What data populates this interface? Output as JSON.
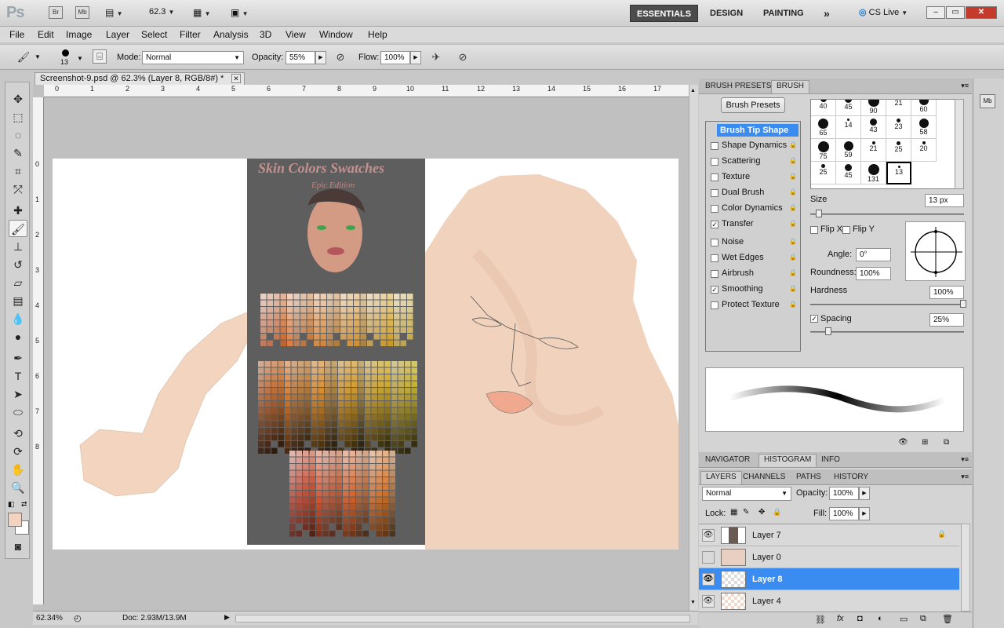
{
  "app": {
    "logo": "Ps",
    "bridge": "Br",
    "minibridge": "Mb",
    "zoom_display": "62.3",
    "workspaces": [
      "ESSENTIALS",
      "DESIGN",
      "PAINTING"
    ],
    "more": "»",
    "cslive": "CS Live",
    "window_controls": [
      "–",
      "▭",
      "✕"
    ]
  },
  "menu": [
    "File",
    "Edit",
    "Image",
    "Layer",
    "Select",
    "Filter",
    "Analysis",
    "3D",
    "View",
    "Window",
    "Help"
  ],
  "options": {
    "brush_size": "13",
    "mode_label": "Mode:",
    "mode_value": "Normal",
    "opacity_label": "Opacity:",
    "opacity_value": "55%",
    "flow_label": "Flow:",
    "flow_value": "100%"
  },
  "document": {
    "tab_title": "Screenshot-9.psd @ 62.3% (Layer 8, RGB/8#) *",
    "ruler_h": [
      "0",
      "1",
      "2",
      "3",
      "4",
      "5",
      "6",
      "7",
      "8",
      "9",
      "10",
      "11",
      "12",
      "13",
      "14",
      "15",
      "16",
      "17"
    ],
    "ruler_v": [
      "0",
      "1",
      "2",
      "3",
      "4",
      "5",
      "6",
      "7",
      "8"
    ],
    "swatch_title": "Skin Colors Swatches",
    "swatch_subtitle": "Epic Edition"
  },
  "status": {
    "zoom": "62.34%",
    "doc": "Doc: 2.93M/13.9M"
  },
  "brush_panel": {
    "tabs": [
      "BRUSH PRESETS",
      "BRUSH"
    ],
    "presets_button": "Brush Presets",
    "settings": [
      {
        "label": "Brush Tip Shape",
        "checked": false,
        "selected": true
      },
      {
        "label": "Shape Dynamics",
        "checked": false
      },
      {
        "label": "Scattering",
        "checked": false
      },
      {
        "label": "Texture",
        "checked": false
      },
      {
        "label": "Dual Brush",
        "checked": false
      },
      {
        "label": "Color Dynamics",
        "checked": false
      },
      {
        "label": "Transfer",
        "checked": true
      },
      {
        "label": "Noise",
        "checked": false
      },
      {
        "label": "Wet Edges",
        "checked": false
      },
      {
        "label": "Airbrush",
        "checked": false
      },
      {
        "label": "Smoothing",
        "checked": true
      },
      {
        "label": "Protect Texture",
        "checked": false
      }
    ],
    "tip_sizes": [
      "40",
      "45",
      "90",
      "21",
      "60",
      "65",
      "14",
      "43",
      "23",
      "58",
      "75",
      "59",
      "21",
      "25",
      "20",
      "25",
      "45",
      "131",
      "13"
    ],
    "size_label": "Size",
    "size_value": "13 px",
    "flipx": "Flip X",
    "flipy": "Flip Y",
    "angle_label": "Angle:",
    "angle_value": "0°",
    "roundness_label": "Roundness:",
    "roundness_value": "100%",
    "hardness_label": "Hardness",
    "hardness_value": "100%",
    "spacing_label": "Spacing",
    "spacing_value": "25%"
  },
  "nav_tabs": [
    "NAVIGATOR",
    "HISTOGRAM",
    "INFO"
  ],
  "layers_panel": {
    "tabs": [
      "LAYERS",
      "CHANNELS",
      "PATHS",
      "HISTORY"
    ],
    "blend": "Normal",
    "opacity_label": "Opacity:",
    "opacity_value": "100%",
    "lock_label": "Lock:",
    "fill_label": "Fill:",
    "fill_value": "100%",
    "layers": [
      {
        "name": "Layer 7",
        "visible": true,
        "locked": true,
        "selected": false
      },
      {
        "name": "Layer 0",
        "visible": false,
        "locked": false,
        "selected": false
      },
      {
        "name": "Layer 8",
        "visible": true,
        "locked": false,
        "selected": true
      },
      {
        "name": "Layer 4",
        "visible": true,
        "locked": false,
        "selected": false
      }
    ]
  },
  "colors": {
    "fg": "#f3d3c0",
    "bg": "#ffffff",
    "accent": "#3b8cf0",
    "skin": "#f2d4bf"
  }
}
